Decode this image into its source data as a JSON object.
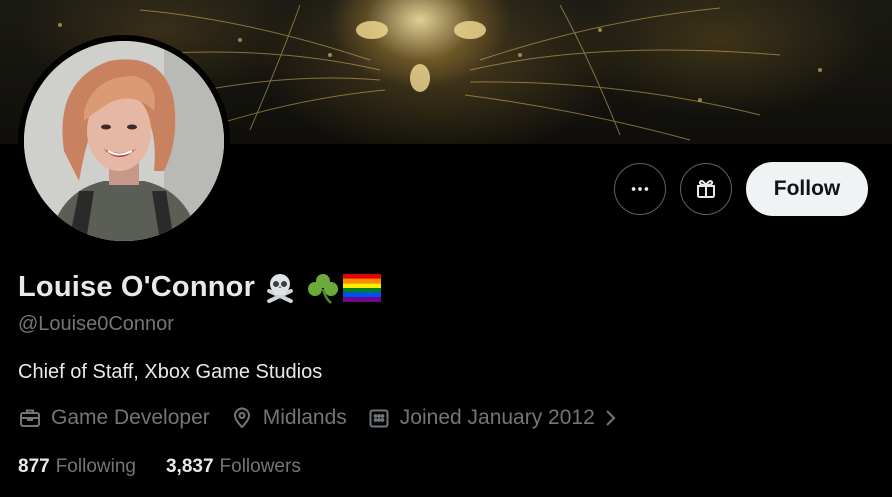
{
  "profile": {
    "name": "Louise O'Connor",
    "handle": "@Louise0Connor",
    "bio": "Chief of Staff, Xbox Game Studios",
    "emojis": [
      "skull-and-crossbones",
      "shamrock",
      "rainbow-flag"
    ]
  },
  "actions": {
    "more_icon": "more-horizontal-icon",
    "gift_icon": "gift-icon",
    "follow_label": "Follow"
  },
  "meta": {
    "profession": "Game Developer",
    "location": "Midlands",
    "joined": "Joined January 2012"
  },
  "stats": {
    "following_count": "877",
    "following_label": "Following",
    "followers_count": "3,837",
    "followers_label": "Followers"
  },
  "colors": {
    "background": "#000000",
    "primary_text": "#e7e9ea",
    "secondary_text": "#71767b",
    "follow_button_bg": "#eff3f4",
    "border": "#536471"
  }
}
